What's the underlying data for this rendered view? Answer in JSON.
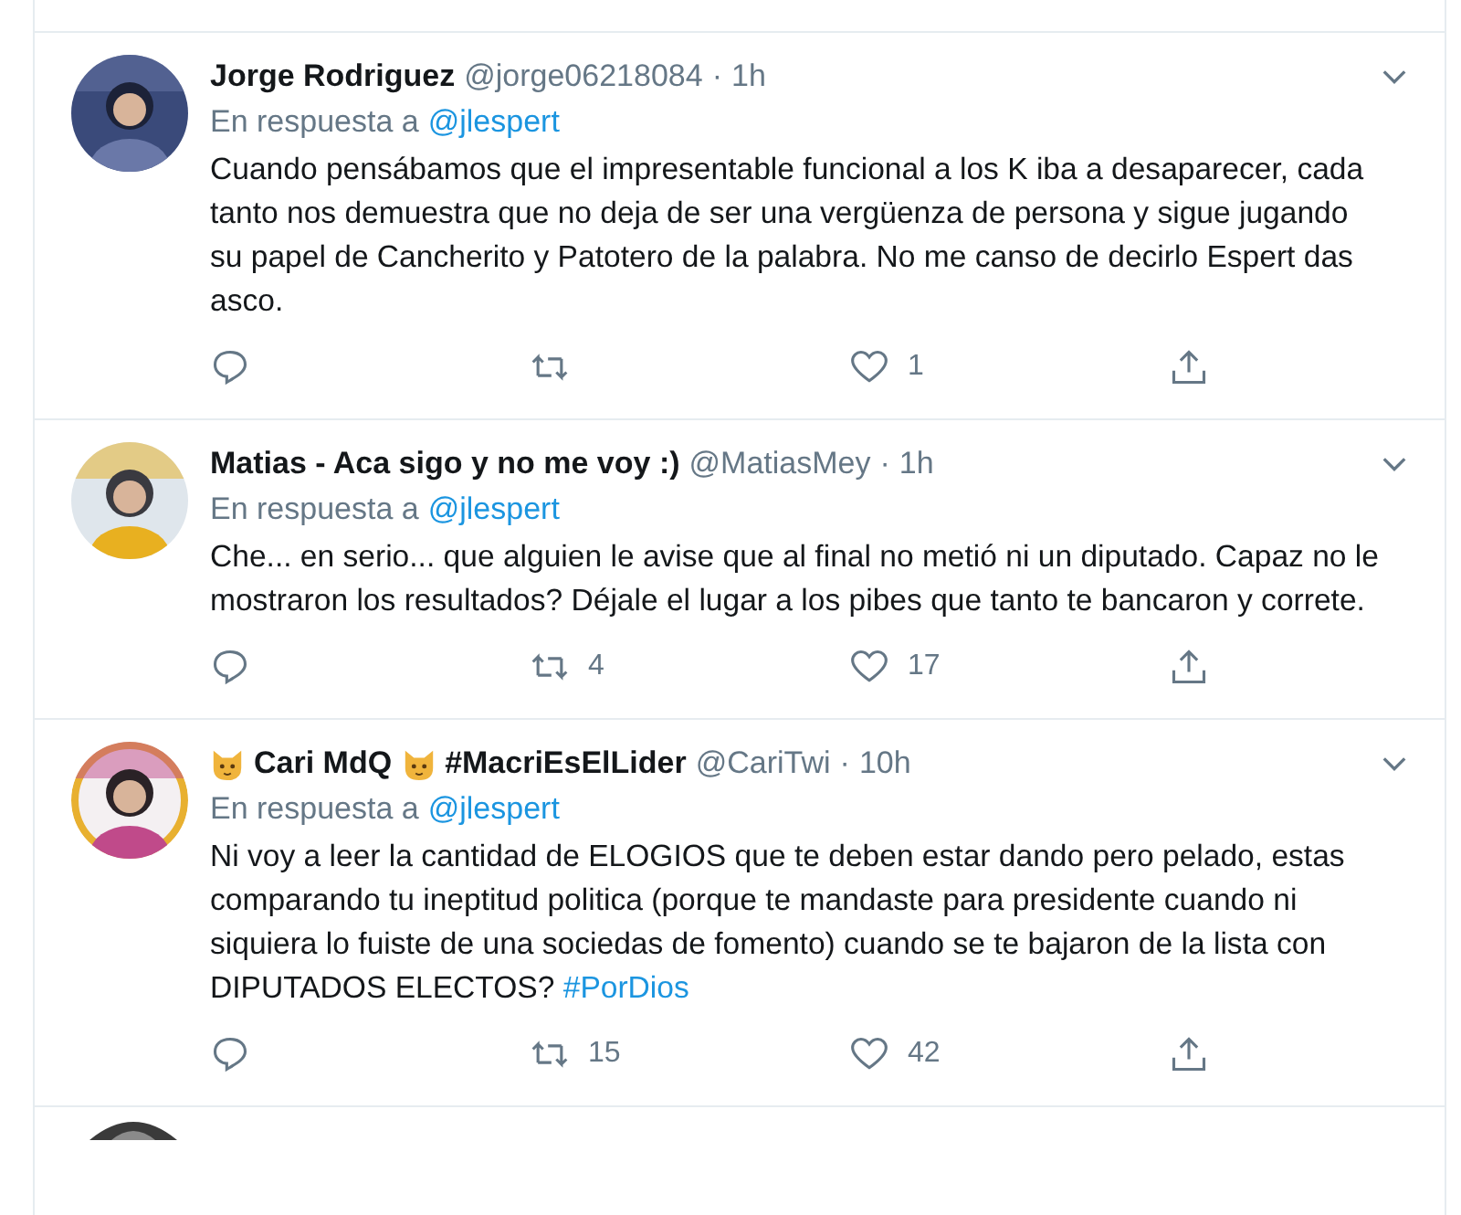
{
  "tweets": [
    {
      "name_parts": [
        {
          "kind": "text",
          "text": "Jorge Rodriguez"
        }
      ],
      "handle": "@jorge06218084",
      "sep": "·",
      "time": "1h",
      "reply_label": "En respuesta a",
      "reply_to": "@jlespert",
      "text": "Cuando pensábamos que el impresentable funcional a los K iba a desaparecer, cada tanto nos demuestra que no deja de ser una vergüenza de persona y sigue jugando su papel de Cancherito y Patotero de la palabra. No me canso de decirlo Espert das asco.",
      "likes": "1"
    },
    {
      "name_parts": [
        {
          "kind": "text",
          "text": "Matias - Aca sigo y no me voy :)"
        }
      ],
      "handle": "@MatiasMey",
      "sep": "·",
      "time": "1h",
      "reply_label": "En respuesta a",
      "reply_to": "@jlespert",
      "text": "Che... en serio... que alguien le avise que al final no metió ni un diputado. Capaz no le mostraron los resultados? Déjale el lugar a los pibes que tanto te bancaron y correte.",
      "retweets": "4",
      "likes": "17"
    },
    {
      "name_parts": [
        {
          "kind": "cat"
        },
        {
          "kind": "text",
          "text": "Cari MdQ"
        },
        {
          "kind": "cat"
        },
        {
          "kind": "text",
          "text": "#MacriEsElLider"
        }
      ],
      "handle": "@CariTwi",
      "sep": "·",
      "time": "10h",
      "reply_label": "En respuesta a",
      "reply_to": "@jlespert",
      "text": "Ni voy a leer la cantidad de ELOGIOS que te deben estar dando pero pelado, estas comparando tu ineptitud politica (porque te mandaste para presidente cuando ni siquiera lo fuiste de una sociedas de fomento) cuando se te bajaron de la lista con DIPUTADOS ELECTOS?",
      "hashtag": "#PorDios",
      "retweets": "15",
      "likes": "42"
    }
  ]
}
